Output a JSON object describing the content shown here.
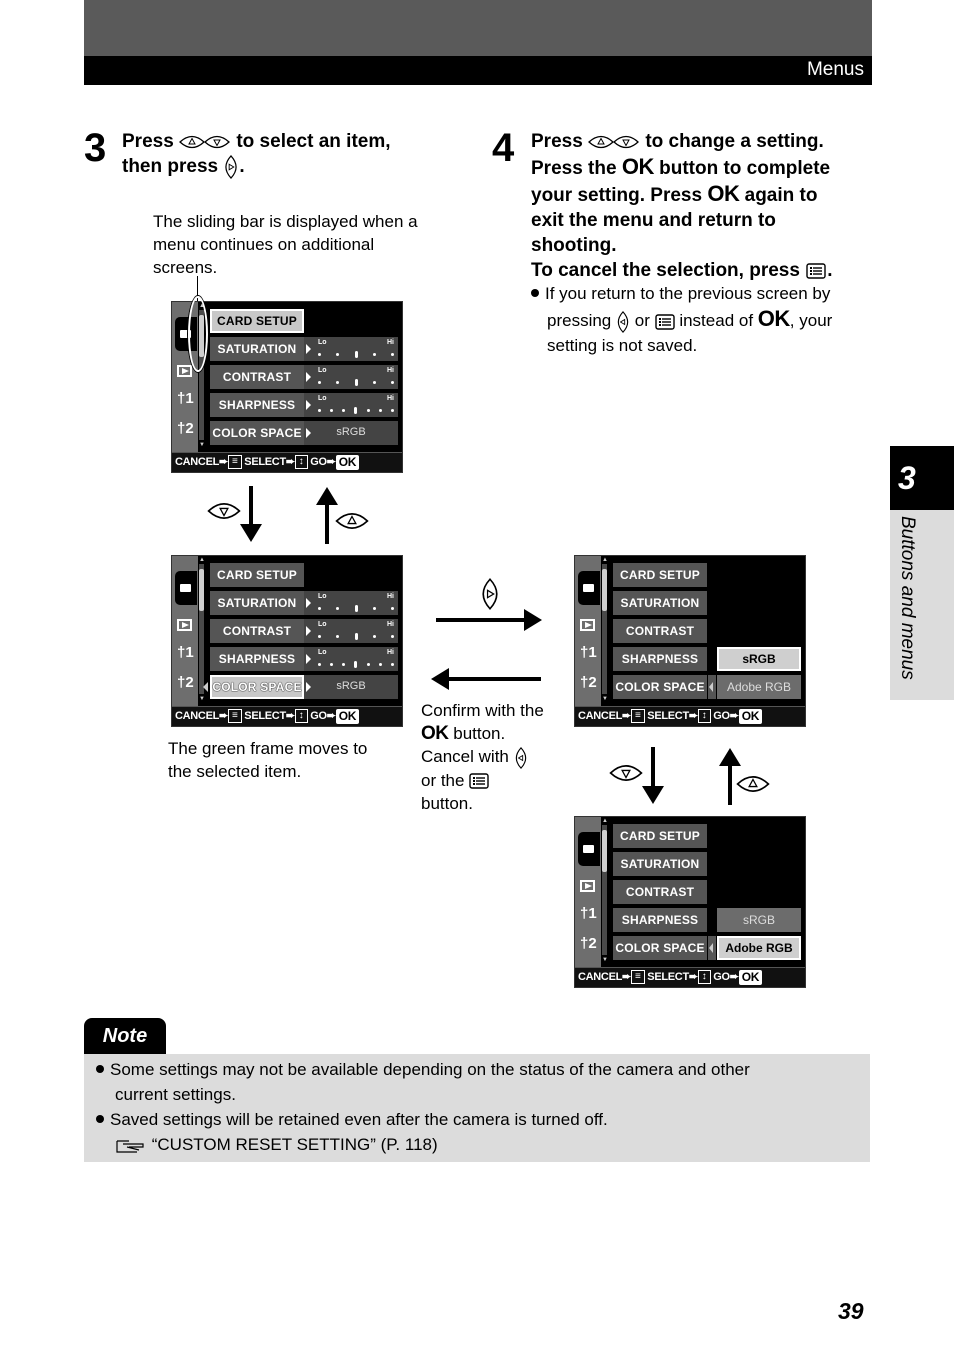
{
  "header": {
    "section_title": "Menus"
  },
  "step3": {
    "number": "3",
    "text_a": "Press",
    "text_b": "to select an item,",
    "text_c": "then press",
    "text_d": ".",
    "callout": [
      "The sliding bar is displayed when a",
      "menu continues on additional",
      "screens."
    ]
  },
  "step4": {
    "number": "4",
    "line1_a": "Press",
    "line1_b": "to change a setting.",
    "line2_a": "Press the",
    "line2_ok": "OK",
    "line2_b": "button to complete",
    "line3_a": "your setting. Press",
    "line3_ok": "OK",
    "line3_b": "again to",
    "line4": "exit the menu and return to",
    "line5": "shooting.",
    "line6": "To cancel the selection, press",
    "line6_end": ".",
    "bullet_a": "If you return to the previous screen by",
    "bullet_b1": "pressing",
    "bullet_b2": "or",
    "bullet_b3": "instead of",
    "bullet_ok": "OK",
    "bullet_b4": ", your",
    "bullet_c": "setting is not saved."
  },
  "lcd": {
    "items": [
      "CARD SETUP",
      "SATURATION",
      "CONTRAST",
      "SHARPNESS",
      "COLOR SPACE"
    ],
    "lo": "Lo",
    "hi": "Hi",
    "color_space_value": "sRGB",
    "options": [
      "sRGB",
      "Adobe RGB"
    ],
    "tabs": [
      "1",
      "2"
    ],
    "footer": {
      "cancel": "CANCEL",
      "select": "SELECT",
      "go": "GO",
      "ok": "OK"
    },
    "screens": [
      {
        "name": "screen-1",
        "selected_item": "CARD SETUP"
      },
      {
        "name": "screen-2",
        "selected_item": "COLOR SPACE"
      },
      {
        "name": "screen-3",
        "selected_option": "sRGB"
      },
      {
        "name": "screen-4",
        "selected_option": "Adobe RGB"
      }
    ]
  },
  "captions": {
    "green_frame": [
      "The green frame moves to",
      "the selected item."
    ],
    "confirm_a": "Confirm with the",
    "confirm_ok": "OK",
    "confirm_b": "button.",
    "cancel_a": "Cancel with",
    "cancel_b": "or the",
    "cancel_c": "button."
  },
  "note": {
    "label": "Note",
    "bullets": [
      "Some settings may not be available depending on the status of the camera and other",
      "current settings.",
      "Saved settings will be retained even after the camera is turned off."
    ],
    "reference": "“CUSTOM RESET SETTING” (P. 118)"
  },
  "side_tab": {
    "chapter": "3",
    "label": "Buttons and menus"
  },
  "page_number": "39"
}
